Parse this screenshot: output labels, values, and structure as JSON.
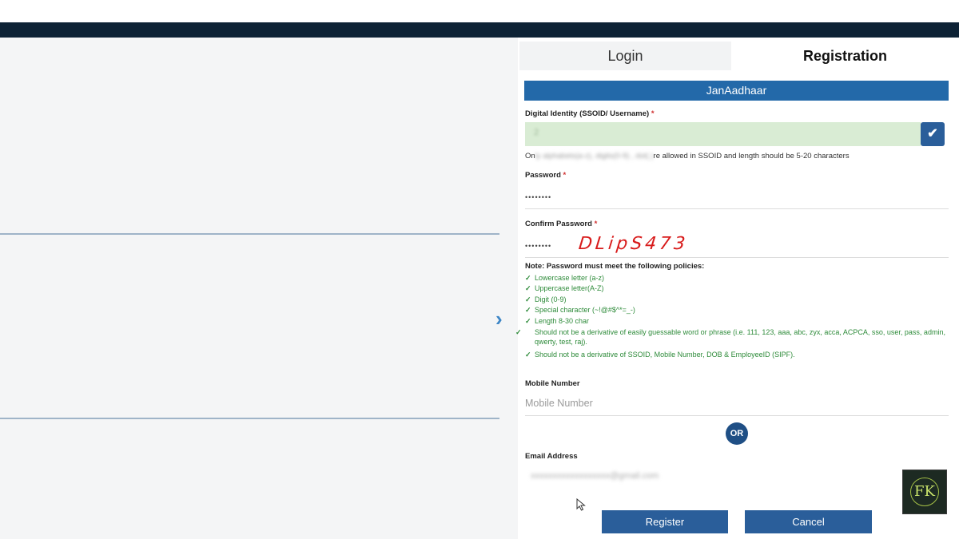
{
  "tabs": {
    "login": "Login",
    "registration": "Registration"
  },
  "banner": "JanAadhaar",
  "ssoid": {
    "label": "Digital Identity (SSOID/ Username)",
    "required_mark": "*",
    "value": "2",
    "hint_prefix": "On",
    "hint_blurred": "ly alphabets(a-z), digits(0-9) , dot(.)",
    "hint_suffix": "re allowed in SSOID and length should be 5-20 characters"
  },
  "password": {
    "label": "Password",
    "required_mark": "*",
    "value": "••••••••"
  },
  "confirm_password": {
    "label": "Confirm Password",
    "required_mark": "*",
    "value": "••••••••",
    "handwritten_note": "DLipS473"
  },
  "policy": {
    "title": "Note: Password must meet the following policies:",
    "items": [
      "Lowercase letter (a-z)",
      "Uppercase letter(A-Z)",
      "Digit (0-9)",
      "Special character (~!@#$^*=_-)",
      "Length 8-30 char",
      "Should not be a derivative of easily guessable word or phrase (i.e. 111, 123, aaa, abc, zyx, acca, ACPCA, sso, user, pass, admin, qwerty, test, raj).",
      "Should not be a derivative of SSOID, Mobile Number, DOB & EmployeeID (SIPF)."
    ]
  },
  "mobile": {
    "label": "Mobile Number",
    "placeholder": "Mobile Number"
  },
  "or_label": "OR",
  "email": {
    "label": "Email Address",
    "value": "xxxxxxxxxxxxxxxxxx@gmail.com"
  },
  "buttons": {
    "register": "Register",
    "cancel": "Cancel"
  },
  "logo_text": "FK",
  "colors": {
    "primary": "#2369a9",
    "button": "#2a5e9a",
    "topbar": "#0d2235",
    "valid_green": "#2e8b3a",
    "ssoid_bg": "#d9ecd4"
  }
}
